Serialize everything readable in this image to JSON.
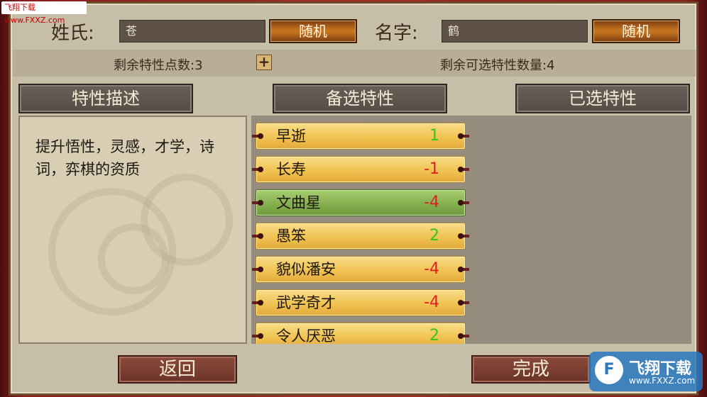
{
  "header": {
    "surname_label": "姓氏:",
    "surname_value": "苍",
    "random_label": "随机",
    "name_label": "名字:",
    "name_value": "鹤"
  },
  "points": {
    "remaining_points_label": "剩余特性点数:3",
    "remaining_selectable_label": "剩余可选特性数量:4"
  },
  "tabs": {
    "description": "特性描述",
    "candidate": "备选特性",
    "selected": "已选特性"
  },
  "description_text": "提升悟性，灵感，才学，诗词，弈棋的资质",
  "traits": [
    {
      "name": "早逝",
      "value": "1",
      "selected": false
    },
    {
      "name": "长寿",
      "value": "-1",
      "selected": false
    },
    {
      "name": "文曲星",
      "value": "-4",
      "selected": true
    },
    {
      "name": "愚笨",
      "value": "2",
      "selected": false
    },
    {
      "name": "貌似潘安",
      "value": "-4",
      "selected": false
    },
    {
      "name": "武学奇才",
      "value": "-4",
      "selected": false
    },
    {
      "name": "令人厌恶",
      "value": "2",
      "selected": false
    }
  ],
  "buttons": {
    "back": "返回",
    "done": "完成"
  },
  "watermark": {
    "text": "飞翔下载 www.FXXZ.com"
  },
  "logo": {
    "title": "飞翔下载",
    "url": "www.FXXZ.com"
  },
  "colors": {
    "positive": "#35c51b",
    "negative": "#e02020",
    "selected_trait": "#82ad4c"
  }
}
